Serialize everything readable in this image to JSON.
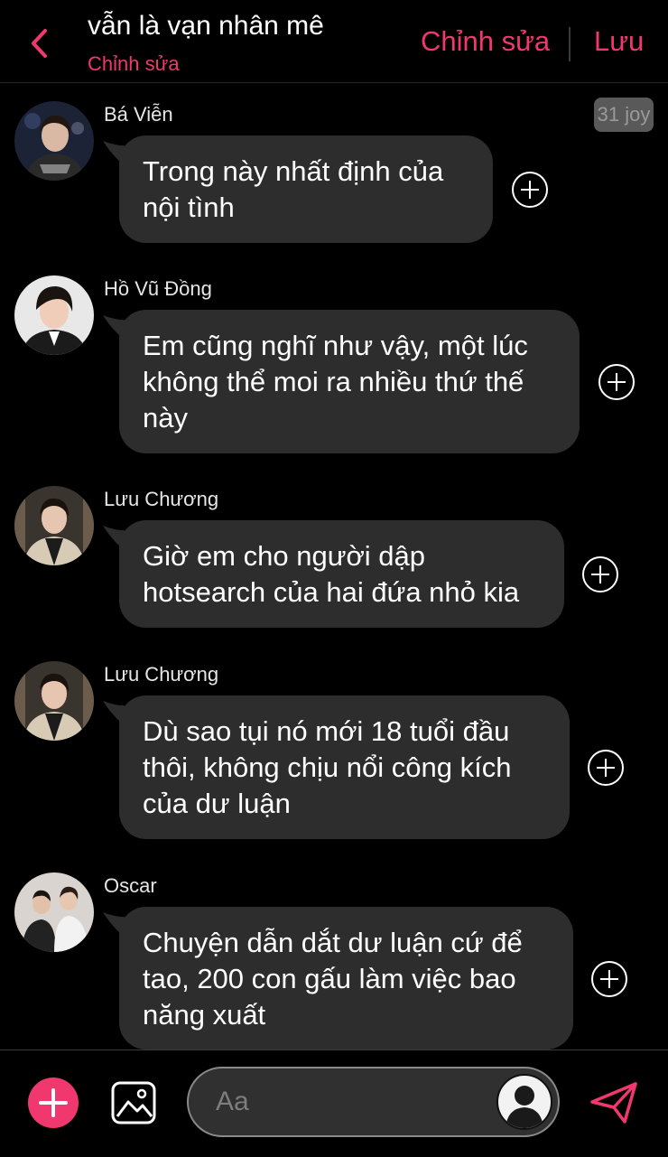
{
  "header": {
    "title": "vẫn là vạn nhân mê",
    "subtitle": "Chỉnh sửa",
    "edit_label": "Chỉnh sửa",
    "save_label": "Lưu",
    "back_icon": "chevron-left-icon",
    "accent_color": "#f0386e"
  },
  "badge": "31 joy",
  "messages": [
    {
      "sender": "Bá Viễn",
      "lines": [
        "Trong này nhất định của",
        "nội tình"
      ]
    },
    {
      "sender": "Hồ Vũ Đồng",
      "lines": [
        "Em cũng nghĩ như vậy, một lúc",
        "không thể moi ra nhiều thứ thế",
        "này"
      ]
    },
    {
      "sender": "Lưu Chương",
      "lines": [
        "Giờ em cho người dập",
        "hotsearch của hai đứa nhỏ kia"
      ]
    },
    {
      "sender": "Lưu Chương",
      "lines": [
        "Dù sao tụi nó mới 18 tuổi đầu",
        "thôi, không chịu nổi công kích",
        "của dư luận"
      ]
    },
    {
      "sender": "Oscar",
      "lines": [
        "Chuyện dẫn dắt dư luận cứ để",
        "tao, 200 con gấu làm việc bao",
        "năng xuất"
      ]
    }
  ],
  "composer": {
    "placeholder": "Aa",
    "plus_icon": "plus-icon",
    "image_icon": "image-icon",
    "send_icon": "send-icon",
    "avatar_icon": "user-silhouette-icon"
  }
}
